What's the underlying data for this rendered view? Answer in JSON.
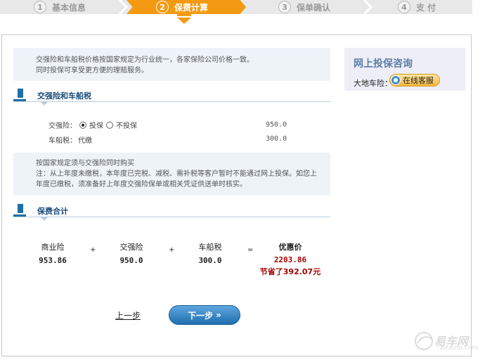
{
  "steps": [
    {
      "num": "1",
      "label": "基本信息"
    },
    {
      "num": "2",
      "label": "保费计算"
    },
    {
      "num": "3",
      "label": "保单确认"
    },
    {
      "num": "4",
      "label": "支 付"
    }
  ],
  "active_step": 2,
  "colors": {
    "accent": "#f39a12",
    "title_blue": "#1b4d7c",
    "price_red": "#a40000",
    "button_blue": "#1f6eb0"
  },
  "notice": {
    "line1": "交强险和车船税价格按国家规定为行业统一，各家保险公司价格一致。",
    "line2": "同时投保可享受更方便的理赔服务。"
  },
  "tax_section": {
    "title": "交强险和车船税",
    "jqx_label": "交强险：",
    "opt_insure": "投保",
    "opt_no": "不投保",
    "jqx_amount": "950.0",
    "ccs_label": "车船税：",
    "ccs_value": "代缴",
    "ccs_amount": "300.0"
  },
  "rule_notice": {
    "line1": "按国家规定须与交强险同时购买",
    "line2": "注：从上年度未缴税，本年度已完税、减税、需补税等客户暂时不能通过网上投保。如您上",
    "line3": "年度已缴税，须准备好上年度交强险保单或相关凭证供送单时核实。"
  },
  "total": {
    "title": "保费合计",
    "commercial_label": "商业险",
    "commercial_value": "953.86",
    "plus1": "+",
    "jqx_label": "交强险",
    "jqx_value": "950.0",
    "plus2": "+",
    "ccs_label": "车船税",
    "ccs_value": "300.0",
    "equals": "=",
    "discount_label": "优惠价",
    "discount_value": "2203.86",
    "savings": "节省了392.07元"
  },
  "nav": {
    "prev": "上一步",
    "next": "下一步"
  },
  "sidebar": {
    "title": "网上投保咨询",
    "label": "大地车险：",
    "service": "在线客服"
  },
  "watermark": {
    "text": "易车网",
    "sub": "bitauto.com"
  }
}
